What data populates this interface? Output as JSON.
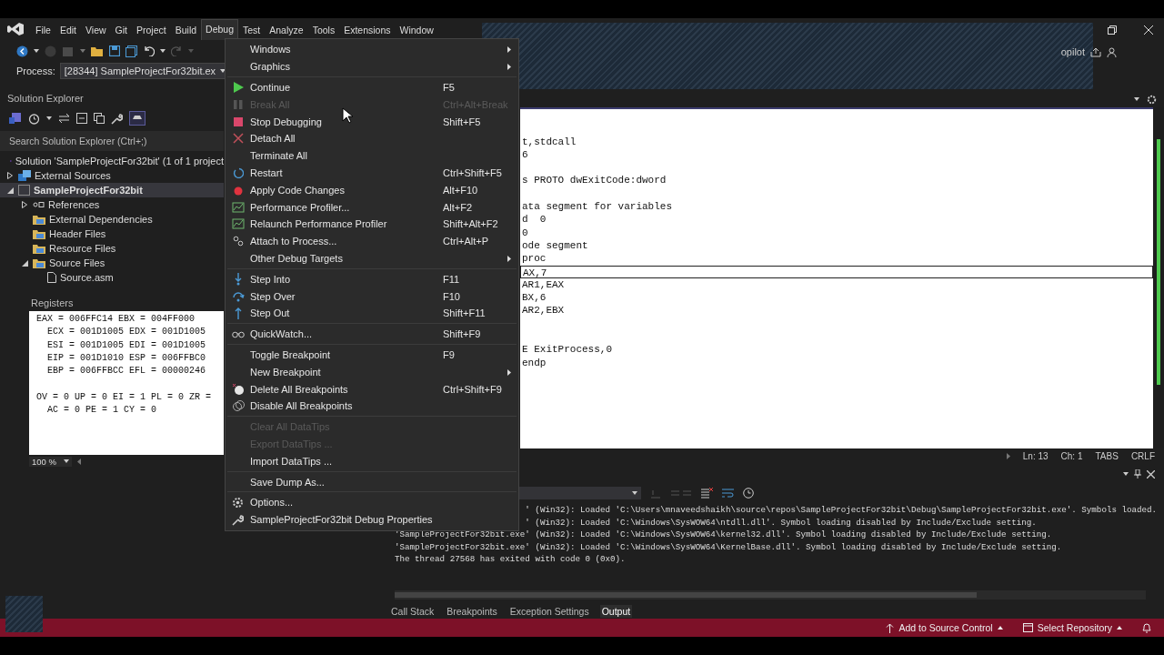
{
  "menubar": {
    "items": [
      {
        "label": "File",
        "selected": false
      },
      {
        "label": "Edit",
        "selected": false
      },
      {
        "label": "View",
        "selected": false
      },
      {
        "label": "Git",
        "selected": false
      },
      {
        "label": "Project",
        "selected": false
      },
      {
        "label": "Build",
        "selected": false
      },
      {
        "label": "Debug",
        "selected": true
      },
      {
        "label": "Test",
        "selected": false
      },
      {
        "label": "Analyze",
        "selected": false
      },
      {
        "label": "Tools",
        "selected": false
      },
      {
        "label": "Extensions",
        "selected": false
      },
      {
        "label": "Window",
        "selected": false
      }
    ]
  },
  "copilot": "opilot",
  "process": {
    "label": "Process:",
    "value": "[28344] SampleProjectFor32bit.ex"
  },
  "solution_explorer": {
    "title": "Solution Explorer",
    "search_placeholder": "Search Solution Explorer (Ctrl+;)",
    "tree": [
      {
        "label": "Solution 'SampleProjectFor32bit' (1 of 1 project",
        "selected": false
      },
      {
        "label": "External Sources",
        "expanded": false,
        "selected": false
      },
      {
        "label": "SampleProjectFor32bit",
        "expanded": true,
        "selected": true,
        "children": [
          {
            "label": "References",
            "expanded": false,
            "selected": false
          },
          {
            "label": "External Dependencies",
            "selected": false
          },
          {
            "label": "Header Files",
            "selected": false
          },
          {
            "label": "Resource Files",
            "selected": false
          },
          {
            "label": "Source Files",
            "expanded": true,
            "selected": false,
            "children": [
              {
                "label": "Source.asm",
                "selected": false
              }
            ]
          }
        ]
      }
    ]
  },
  "registers": {
    "title": "Registers",
    "groups": [
      [
        "EAX = 006FFC14 EBX = 004FF000",
        "  ECX = 001D1005 EDX = 001D1005",
        "  ESI = 001D1005 EDI = 001D1005",
        "  EIP = 001D1010 ESP = 006FFBC0",
        "  EBP = 006FFBCC EFL = 00000246"
      ],
      [
        "OV = 0 UP = 0 EI = 1 PL = 0 ZR =",
        "  AC = 0 PE = 1 CY = 0"
      ]
    ],
    "zoom": "100 %"
  },
  "editor": {
    "lines": [
      {
        "current": false
      },
      {
        "current": false
      },
      {
        "text": "t,stdcall",
        "current": false
      },
      {
        "text": "6",
        "current": false
      },
      {
        "current": false
      },
      {
        "text": "s PROTO dwExitCode:dword",
        "current": false
      },
      {
        "current": false
      },
      {
        "text": "ata segment for variables",
        "current": false
      },
      {
        "text": "d  0",
        "current": false
      },
      {
        "text": "0",
        "current": false
      },
      {
        "text": "ode segment",
        "current": false
      },
      {
        "text": "proc",
        "current": false
      },
      {
        "text": "AX,7",
        "current": true
      },
      {
        "text": "AR1,EAX",
        "current": false
      },
      {
        "text": "BX,6",
        "current": false
      },
      {
        "text": "AR2,EBX",
        "current": false
      },
      {
        "current": false
      },
      {
        "current": false
      },
      {
        "text": "E ExitProcess,0",
        "current": false
      },
      {
        "text": "endp",
        "current": false
      }
    ],
    "status": {
      "line": "Ln: 13",
      "column": "Ch: 1",
      "indent": "TABS",
      "eol": "CRLF"
    }
  },
  "debug_menu": {
    "groups": [
      {
        "items": [
          {
            "label": "Windows",
            "submenu": true,
            "disabled": false
          },
          {
            "label": "Graphics",
            "submenu": true,
            "disabled": false
          }
        ]
      },
      {
        "items": [
          {
            "label": "Continue",
            "shortcut": "F5",
            "submenu": false,
            "disabled": false
          },
          {
            "label": "Break All",
            "shortcut": "Ctrl+Alt+Break",
            "submenu": false,
            "disabled": true
          },
          {
            "label": "Stop Debugging",
            "shortcut": "Shift+F5",
            "submenu": false,
            "disabled": false
          },
          {
            "label": "Detach All",
            "submenu": false,
            "disabled": false
          },
          {
            "label": "Terminate All",
            "submenu": false,
            "disabled": false
          },
          {
            "label": "Restart",
            "shortcut": "Ctrl+Shift+F5",
            "submenu": false,
            "disabled": false
          },
          {
            "label": "Apply Code Changes",
            "shortcut": "Alt+F10",
            "submenu": false,
            "disabled": false
          },
          {
            "label": "Performance Profiler...",
            "shortcut": "Alt+F2",
            "submenu": false,
            "disabled": false
          },
          {
            "label": "Relaunch Performance Profiler",
            "shortcut": "Shift+Alt+F2",
            "submenu": false,
            "disabled": false
          },
          {
            "label": "Attach to Process...",
            "shortcut": "Ctrl+Alt+P",
            "submenu": false,
            "disabled": false
          },
          {
            "label": "Other Debug Targets",
            "submenu": true,
            "disabled": false
          }
        ]
      },
      {
        "items": [
          {
            "label": "Step Into",
            "shortcut": "F11",
            "submenu": false,
            "disabled": false
          },
          {
            "label": "Step Over",
            "shortcut": "F10",
            "submenu": false,
            "disabled": false
          },
          {
            "label": "Step Out",
            "shortcut": "Shift+F11",
            "submenu": false,
            "disabled": false
          }
        ]
      },
      {
        "items": [
          {
            "label": "QuickWatch...",
            "shortcut": "Shift+F9",
            "submenu": false,
            "disabled": false
          }
        ]
      },
      {
        "items": [
          {
            "label": "Toggle Breakpoint",
            "shortcut": "F9",
            "submenu": false,
            "disabled": false
          },
          {
            "label": "New Breakpoint",
            "submenu": true,
            "disabled": false
          },
          {
            "label": "Delete All Breakpoints",
            "shortcut": "Ctrl+Shift+F9",
            "submenu": false,
            "disabled": false
          },
          {
            "label": "Disable All Breakpoints",
            "submenu": false,
            "disabled": false
          }
        ]
      },
      {
        "items": [
          {
            "label": "Clear All DataTips",
            "submenu": false,
            "disabled": true
          },
          {
            "label": "Export DataTips ...",
            "submenu": false,
            "disabled": true
          },
          {
            "label": "Import DataTips ...",
            "submenu": false,
            "disabled": false
          }
        ]
      },
      {
        "items": [
          {
            "label": "Save Dump As...",
            "submenu": false,
            "disabled": false
          }
        ]
      },
      {
        "items": [
          {
            "label": "Options...",
            "submenu": false,
            "disabled": false
          },
          {
            "label": "SampleProjectFor32bit Debug Properties",
            "submenu": false,
            "disabled": false
          }
        ]
      }
    ]
  },
  "output": {
    "lines": [
      {
        "kind": "clipped",
        "text": "' (Win32): Loaded 'C:\\Users\\mnaveedshaikh\\source\\repos\\SampleProjectFor32bit\\Debug\\SampleProjectFor32bit.exe'. Symbols loaded."
      },
      {
        "kind": "clipped",
        "text": "' (Win32): Loaded 'C:\\Windows\\SysWOW64\\ntdll.dll'. Symbol loading disabled by Include/Exclude setting."
      },
      {
        "kind": "full",
        "text": "'SampleProjectFor32bit.exe' (Win32): Loaded 'C:\\Windows\\SysWOW64\\kernel32.dll'. Symbol loading disabled by Include/Exclude setting."
      },
      {
        "kind": "full",
        "text": "'SampleProjectFor32bit.exe' (Win32): Loaded 'C:\\Windows\\SysWOW64\\KernelBase.dll'. Symbol loading disabled by Include/Exclude setting."
      },
      {
        "kind": "full",
        "text": "The thread 27568 has exited with code 0 (0x0)."
      }
    ],
    "tabs": [
      {
        "label": "Call Stack",
        "selected": false
      },
      {
        "label": "Breakpoints",
        "selected": false
      },
      {
        "label": "Exception Settings",
        "selected": false
      },
      {
        "label": "Output",
        "selected": true
      }
    ]
  },
  "status_bar": {
    "items": [
      "Add to Source Control",
      "Select Repository"
    ]
  }
}
